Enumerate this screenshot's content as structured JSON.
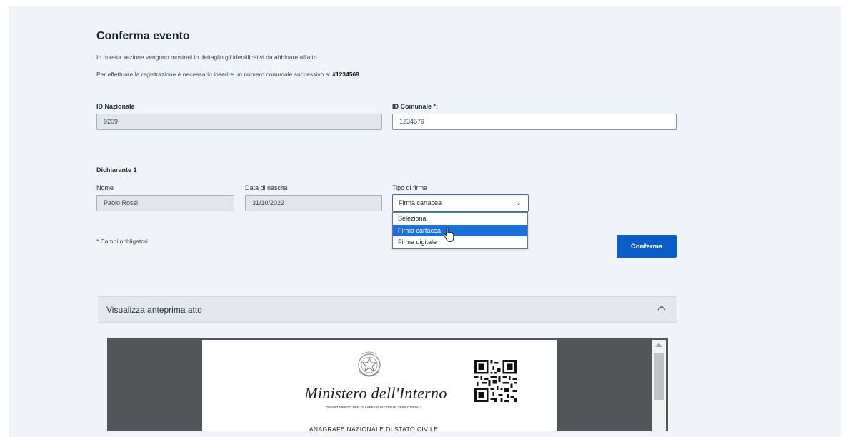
{
  "page": {
    "title": "Conferma evento",
    "description_line1": "In questa sezione vengono mostrati in dettaglio gli identificativi da abbinare all'atto.",
    "description_line2_prefix": "Per effettuare la registrazione è necessario inserire un numero comunale successivo a: ",
    "description_line2_number": "#1234569"
  },
  "ids": {
    "national_label": "ID Nazionale",
    "national_value": "9209",
    "municipal_label": "ID Comunale *:",
    "municipal_value": "1234579"
  },
  "declarant": {
    "section_title": "Dichiarante 1",
    "name_label": "Nome",
    "name_value": "Paolo Rossi",
    "birthdate_label": "Data di nascita",
    "birthdate_value": "31/10/2022",
    "signature_label": "Tipo di firma",
    "signature_value": "Firma cartacea",
    "signature_options": [
      "Seleziona",
      "Firma cartacea",
      "Firma digitale"
    ],
    "signature_highlighted_index": 1
  },
  "form": {
    "required_note": "* Campi obbligatori",
    "confirm_label": "Conferma"
  },
  "preview": {
    "accordion_title": "Visualizza anteprima atto",
    "ministry_name": "Ministero dell'Interno",
    "department": "DIPARTIMENTO PER GLI AFFARI INTERNI E TERRITORIALI",
    "registry_title": "ANAGRAFE NAZIONALE DI STATO CIVILE"
  },
  "colors": {
    "background": "#f0f3f8",
    "primary": "#0b5ec8",
    "option_highlight": "#1f6fd8",
    "viewer_background": "#535659"
  }
}
